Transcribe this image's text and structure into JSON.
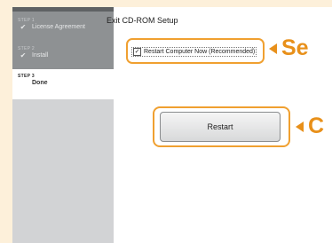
{
  "sidebar": {
    "steps": [
      {
        "num": "STEP 1",
        "label": "License Agreement",
        "done": true
      },
      {
        "num": "STEP 2",
        "label": "Install",
        "done": true
      },
      {
        "num": "STEP 3",
        "label": "Done",
        "done": false
      }
    ]
  },
  "main": {
    "title": "Exit CD-ROM Setup",
    "checkbox_label": "Restart Computer Now (Recommended)",
    "checkbox_checked": true,
    "restart_button": "Restart"
  },
  "callouts": {
    "select_text": "Se",
    "click_text": "C"
  },
  "colors": {
    "accent": "#f0a030",
    "background": "#fdf0da"
  }
}
